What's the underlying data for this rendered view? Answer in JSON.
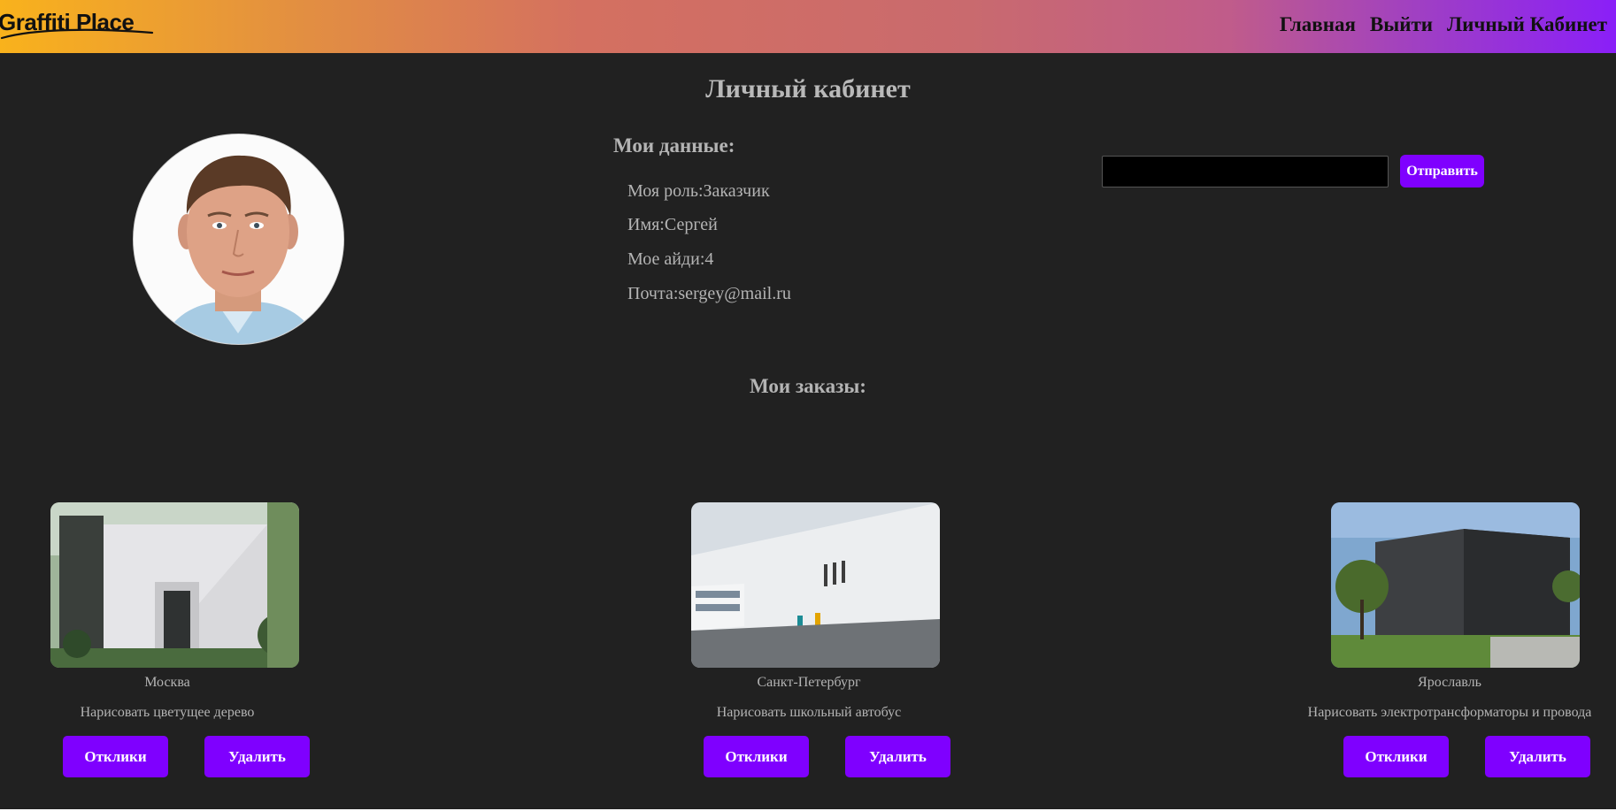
{
  "header": {
    "logo": "Graffiti Place",
    "nav": [
      "Главная",
      "Выйти",
      "Личный Кабинет"
    ]
  },
  "page": {
    "title": "Личный кабинет"
  },
  "profile": {
    "section_title": "Мои данные:",
    "role": "Моя роль:Заказчик",
    "name": "Имя:Сергей",
    "id": "Мое айди:4",
    "email": "Почта:sergey@mail.ru"
  },
  "form": {
    "input_value": "",
    "submit_label": "Отправить"
  },
  "orders": {
    "section_title": "Мои заказы:",
    "items": [
      {
        "city": "Москва",
        "task": "Нарисовать цветущее дерево",
        "responses_label": "Отклики",
        "delete_label": "Удалить"
      },
      {
        "city": "Санкт-Петербург",
        "task": "Нарисовать школьный автобус",
        "responses_label": "Отклики",
        "delete_label": "Удалить"
      },
      {
        "city": "Ярославль",
        "task": "Нарисовать электротрансформаторы и провода",
        "responses_label": "Отклики",
        "delete_label": "Удалить"
      }
    ]
  },
  "colors": {
    "accent": "#7f00ff",
    "background": "#212121",
    "text": "#b4b4b4"
  }
}
